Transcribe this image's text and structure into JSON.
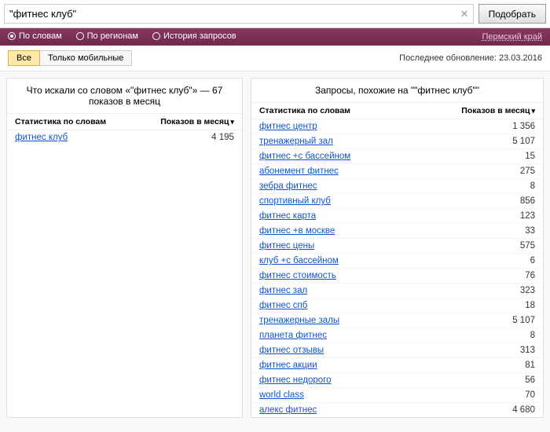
{
  "search": {
    "query": "\"фитнес клуб\"",
    "button": "Подобрать"
  },
  "tabs": {
    "items": [
      {
        "label": "По словам",
        "checked": true
      },
      {
        "label": "По регионам",
        "checked": false
      },
      {
        "label": "История запросов",
        "checked": false
      }
    ],
    "region": "Пермский край"
  },
  "segments": {
    "all": "Все",
    "mobile": "Только мобильные"
  },
  "last_update": "Последнее обновление: 23.03.2016",
  "columns": {
    "stat": "Статистика по словам",
    "shows": "Показов в месяц"
  },
  "left": {
    "title": "Что искали со словом «\"фитнес клуб\"» — 67 показов в месяц",
    "rows": [
      {
        "kw": "фитнес клуб",
        "val": "4 195"
      }
    ]
  },
  "right": {
    "title": "Запросы, похожие на \"\"фитнес клуб\"\"",
    "rows": [
      {
        "kw": "фитнес центр",
        "val": "1 356"
      },
      {
        "kw": "тренажерный зал",
        "val": "5 107"
      },
      {
        "kw": "фитнес +с бассейном",
        "val": "15"
      },
      {
        "kw": "абонемент фитнес",
        "val": "275"
      },
      {
        "kw": "зебра фитнес",
        "val": "8"
      },
      {
        "kw": "спортивный клуб",
        "val": "856"
      },
      {
        "kw": "фитнес карта",
        "val": "123"
      },
      {
        "kw": "фитнес +в москве",
        "val": "33"
      },
      {
        "kw": "фитнес цены",
        "val": "575"
      },
      {
        "kw": "клуб +с бассейном",
        "val": "6"
      },
      {
        "kw": "фитнес стоимость",
        "val": "76"
      },
      {
        "kw": "фитнес зал",
        "val": "323"
      },
      {
        "kw": "фитнес спб",
        "val": "18"
      },
      {
        "kw": "тренажерные залы",
        "val": "5 107"
      },
      {
        "kw": "планета фитнес",
        "val": "8"
      },
      {
        "kw": "фитнес отзывы",
        "val": "313"
      },
      {
        "kw": "фитнес акции",
        "val": "81"
      },
      {
        "kw": "фитнес недорого",
        "val": "56"
      },
      {
        "kw": "world class",
        "val": "70"
      },
      {
        "kw": "алекс фитнес",
        "val": "4 680"
      }
    ]
  }
}
